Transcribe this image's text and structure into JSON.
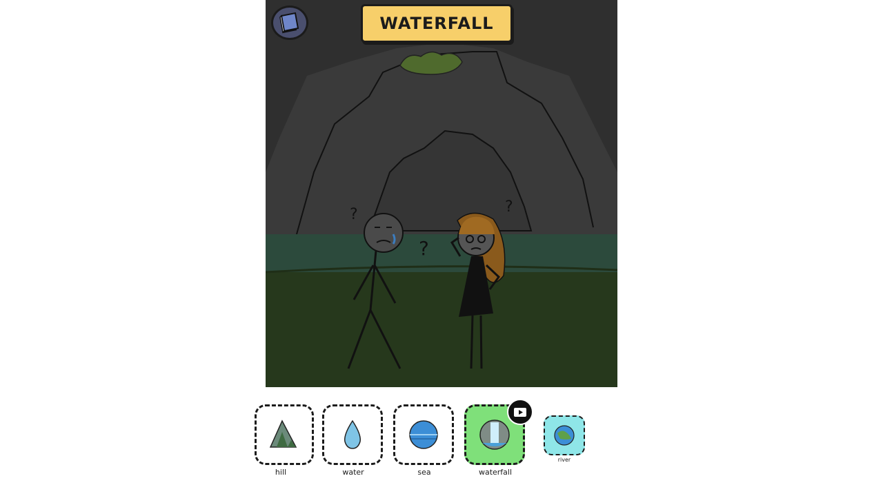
{
  "level": {
    "title": "WATERFALL"
  },
  "hud": {
    "book_icon": "book-icon"
  },
  "scene": {
    "question_marks": [
      "?",
      "?",
      "?"
    ]
  },
  "tray": {
    "items": [
      {
        "label": "hill",
        "icon": "mountain-icon",
        "state": "partial"
      },
      {
        "label": "water",
        "icon": "water-drop-icon",
        "state": "normal"
      },
      {
        "label": "sea",
        "icon": "sea-globe-icon",
        "state": "normal"
      },
      {
        "label": "waterfall",
        "icon": "waterfall-icon",
        "state": "selected",
        "badge_icon": "video-ad-icon"
      },
      {
        "label": "river",
        "icon": "river-globe-icon",
        "state": "small"
      }
    ]
  },
  "colors": {
    "banner": "#f7cf6a",
    "selected_card": "#7fe07a",
    "river_card": "#8fe6e8",
    "night_sky": "#2b2b2b"
  }
}
